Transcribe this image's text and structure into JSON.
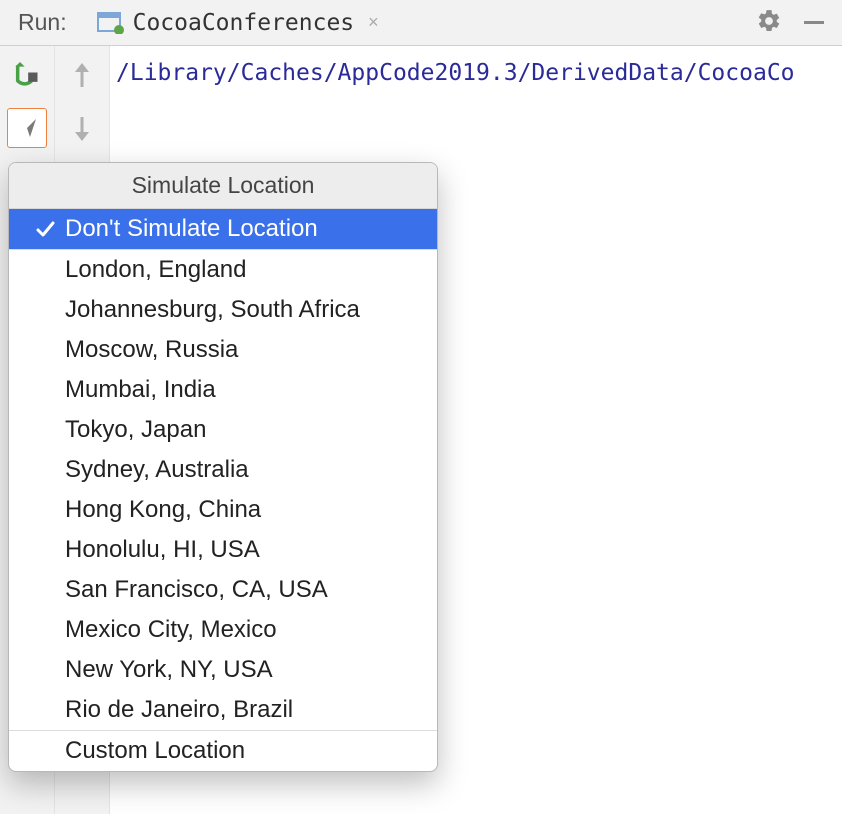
{
  "titlebar": {
    "run_label": "Run:",
    "tab_label": "CocoaConferences",
    "tab_close": "×"
  },
  "content": {
    "path": "/Library/Caches/AppCode2019.3/DerivedData/CocoaCo"
  },
  "popup": {
    "header": "Simulate Location",
    "selected_item": "Don't Simulate Location",
    "items": [
      "London, England",
      "Johannesburg, South Africa",
      "Moscow, Russia",
      "Mumbai, India",
      "Tokyo, Japan",
      "Sydney, Australia",
      "Hong Kong, China",
      "Honolulu, HI, USA",
      "San Francisco, CA, USA",
      "Mexico City, Mexico",
      "New York, NY, USA",
      "Rio de Janeiro, Brazil"
    ],
    "custom": "Custom Location"
  }
}
